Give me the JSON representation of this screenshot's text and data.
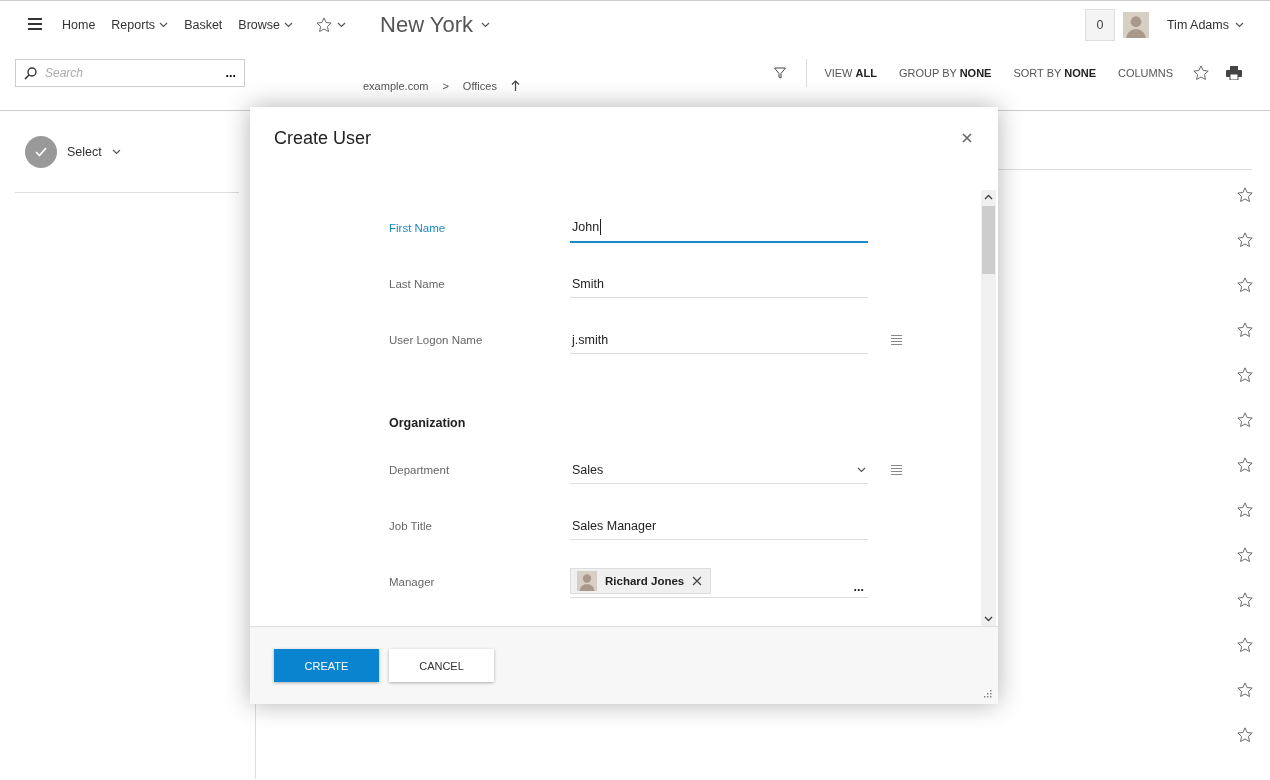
{
  "header": {
    "nav": [
      {
        "label": "Home",
        "dropdown": false
      },
      {
        "label": "Reports",
        "dropdown": true
      },
      {
        "label": "Basket",
        "dropdown": false
      },
      {
        "label": "Browse",
        "dropdown": true
      }
    ],
    "location": "New York",
    "notification_count": "0",
    "user": "Tim Adams",
    "search": {
      "placeholder": "Search",
      "more": "..."
    },
    "breadcrumb": {
      "items": [
        "example.com",
        "Offices"
      ],
      "separator": ">"
    },
    "toolbar": [
      "VIEW **ALL**",
      "GROUP BY **NONE**",
      "SORT BY **NONE**",
      "COLUMNS"
    ]
  },
  "sidebar": {
    "select_label": "Select"
  },
  "list": {
    "rows": [
      {
        "favorite": false
      },
      {
        "favorite": false
      },
      {
        "favorite": false
      },
      {
        "favorite": false
      },
      {
        "favorite": false
      },
      {
        "favorite": false
      },
      {
        "favorite": false
      },
      {
        "favorite": false
      },
      {
        "favorite": false
      },
      {
        "favorite": false
      },
      {
        "favorite": false
      },
      {
        "favorite": false
      },
      {
        "favorite": false
      }
    ]
  },
  "dialog": {
    "title": "Create User",
    "sections": [
      {
        "fields": [
          {
            "kind": "text",
            "label": "First Name",
            "value": "John",
            "focused": true,
            "list_icon": false
          },
          {
            "kind": "text",
            "label": "Last Name",
            "value": "Smith",
            "focused": false,
            "list_icon": false
          },
          {
            "kind": "text",
            "label": "User Logon Name",
            "value": "j.smith",
            "focused": false,
            "list_icon": true
          }
        ]
      },
      {
        "heading": "Organization",
        "fields": [
          {
            "kind": "select",
            "label": "Department",
            "value": "Sales",
            "focused": false,
            "list_icon": true
          },
          {
            "kind": "text",
            "label": "Job Title",
            "value": "Sales Manager",
            "focused": false,
            "list_icon": false
          },
          {
            "kind": "people",
            "label": "Manager",
            "value": "Richard Jones",
            "more": "...",
            "focused": false,
            "list_icon": false
          }
        ]
      }
    ],
    "buttons": [
      {
        "label": "CREATE",
        "primary": true
      },
      {
        "label": "CANCEL",
        "primary": false
      }
    ]
  }
}
